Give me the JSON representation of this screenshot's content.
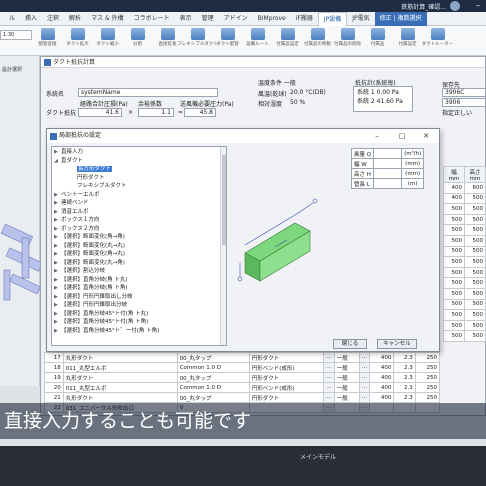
{
  "titlebar": {
    "file_name": "鉄筋計算_確認..."
  },
  "ribbon_tabs": [
    "ル",
    "挿入",
    "注釈",
    "解析",
    "マス & 外構",
    "コラボレート",
    "表示",
    "管理",
    "アドイン",
    "BIMprove",
    "iF搬器",
    "JP設備",
    "JP電気",
    "修正 | 複数選択"
  ],
  "ribbon_buttons": [
    "配管変換",
    "ダクト拡大",
    "ダクト縮小",
    "分割",
    "直接延長",
    "フレキシブルダクト",
    "ダクト配管",
    "設備ルート",
    "付属品設定",
    "付属品の移動",
    "付属品の削除",
    "付属品",
    "付属設定",
    "ダクトルーター"
  ],
  "left_combo": "1:30",
  "left_label": "設計選択",
  "main_dialog": {
    "title": "ダクト抵抗計算",
    "system_name_label": "系統名",
    "system_name_value": "systemName",
    "duct_resistance_label": "ダクト抵抗",
    "path_label": "経路合計圧損(Pa)",
    "margin_label": "余裕係数",
    "required_label": "送風機必要圧力(Pa)",
    "path_value": "41.6",
    "op_times": "×",
    "margin_value": "1.1",
    "op_equals": "=",
    "required_value": "45.8",
    "temp_header": "温度条件  一般",
    "temp_label": "風温(乾球)",
    "temp_value": "20.0 °C(DB)",
    "humid_label": "相対湿度",
    "humid_value": "50 %",
    "resist_header": "抵抗計(系統毎)",
    "resist_line1": "系統 1  0.00 Pa",
    "resist_line2": "系統 2  41.60 Pa",
    "save_header": "保存先",
    "save_value1": "3906C",
    "save_value2": "3906",
    "save_label": "指定正しい"
  },
  "right_table": {
    "col1": "幅\nmm",
    "col2": "高さ\nmm",
    "rows": [
      [
        "400",
        "600"
      ],
      [
        "400",
        "500"
      ],
      [
        "500",
        "500"
      ],
      [
        "500",
        "500"
      ],
      [
        "500",
        "500"
      ],
      [
        "500",
        "500"
      ],
      [
        "500",
        "500"
      ],
      [
        "500",
        "500"
      ],
      [
        "500",
        "500"
      ],
      [
        "500",
        "500"
      ],
      [
        "500",
        "500"
      ],
      [
        "500",
        "500"
      ],
      [
        "500",
        "500"
      ],
      [
        "500",
        "500"
      ],
      [
        "500",
        "500"
      ]
    ]
  },
  "inner_dialog": {
    "title": "局部抵抗の設定",
    "close_btn": "閉じる",
    "cancel_btn": "キャンセル",
    "tree": [
      {
        "label": "直接入力",
        "level": 0,
        "arrow": "▶"
      },
      {
        "label": "直ダクト",
        "level": 0,
        "arrow": "◢"
      },
      {
        "label": "長方形ダクト",
        "level": 1,
        "arrow": "",
        "selected": true
      },
      {
        "label": "円形ダクト",
        "level": 1,
        "arrow": ""
      },
      {
        "label": "フレキシブルダクト",
        "level": 1,
        "arrow": ""
      },
      {
        "label": "ベントーエルボ",
        "level": 0,
        "arrow": "▶"
      },
      {
        "label": "連続ベンド",
        "level": 0,
        "arrow": "▶"
      },
      {
        "label": "消音エルボ",
        "level": 0,
        "arrow": "▶"
      },
      {
        "label": "ボックス１方向",
        "level": 0,
        "arrow": "▶"
      },
      {
        "label": "ボックス２方向",
        "level": 0,
        "arrow": "▶"
      },
      {
        "label": "【選択】断面変化(角→角)",
        "level": 0,
        "arrow": "▶"
      },
      {
        "label": "【選択】断面変化(丸→丸)",
        "level": 0,
        "arrow": "▶"
      },
      {
        "label": "【選択】断面変化(角→丸)",
        "level": 0,
        "arrow": "▶"
      },
      {
        "label": "【選択】断面変化(丸→角)",
        "level": 0,
        "arrow": "▶"
      },
      {
        "label": "【選択】割込分岐",
        "level": 0,
        "arrow": "▶"
      },
      {
        "label": "【選択】直角分岐(角 ト丸)",
        "level": 0,
        "arrow": "▶"
      },
      {
        "label": "【選択】直角分岐(角 ト角)",
        "level": 0,
        "arrow": "▶"
      },
      {
        "label": "【選択】円形円錐取出し分岐",
        "level": 0,
        "arrow": "▶"
      },
      {
        "label": "【選択】円形円錐取出分岐",
        "level": 0,
        "arrow": "▶"
      },
      {
        "label": "【選択】直角分岐45°ト付(角 ト丸)",
        "level": 0,
        "arrow": "▶"
      },
      {
        "label": "【選択】直角分岐45°ト付(角 ト角)",
        "level": 0,
        "arrow": "▶"
      },
      {
        "label": "【選択】直角分岐45°ト゛ー付(角 ト角)",
        "level": 0,
        "arrow": "▶"
      }
    ],
    "props": [
      {
        "name": "風量 Q",
        "value": "",
        "unit": "(m³/h)"
      },
      {
        "name": "幅  W",
        "value": "",
        "unit": "(mm)"
      },
      {
        "name": "高さ H",
        "value": "",
        "unit": "(mm)"
      },
      {
        "name": "管長 L",
        "value": "",
        "unit": "(m)"
      }
    ]
  },
  "bottom_table": [
    [
      "17",
      "丸形ダクト",
      "00_丸タップ",
      "円形ダクト",
      "一般",
      "400",
      "2.3",
      "250"
    ],
    [
      "18",
      "011_丸型エルボ",
      "Common 1.0 D",
      "円形ベンド(成形)",
      "一般",
      "400",
      "2.3",
      "250"
    ],
    [
      "19",
      "丸形ダクト",
      "00_丸タップ",
      "円形ダクト",
      "一般",
      "400",
      "2.3",
      "250"
    ],
    [
      "20",
      "011_丸型エルボ",
      "Common 1.0 D",
      "円形ベンド(成形)",
      "一般",
      "400",
      "2.3",
      "250"
    ],
    [
      "21",
      "丸形ダクト",
      "00_丸タップ",
      "円形ダクト",
      "一般",
      "400",
      "2.3",
      "250"
    ],
    [
      "22",
      "031_ユニバーサル形吹出口",
      "V",
      "",
      "",
      "",
      "",
      ""
    ]
  ],
  "subtitle": "直接入力することも可能です",
  "status_text": "メインモデル"
}
